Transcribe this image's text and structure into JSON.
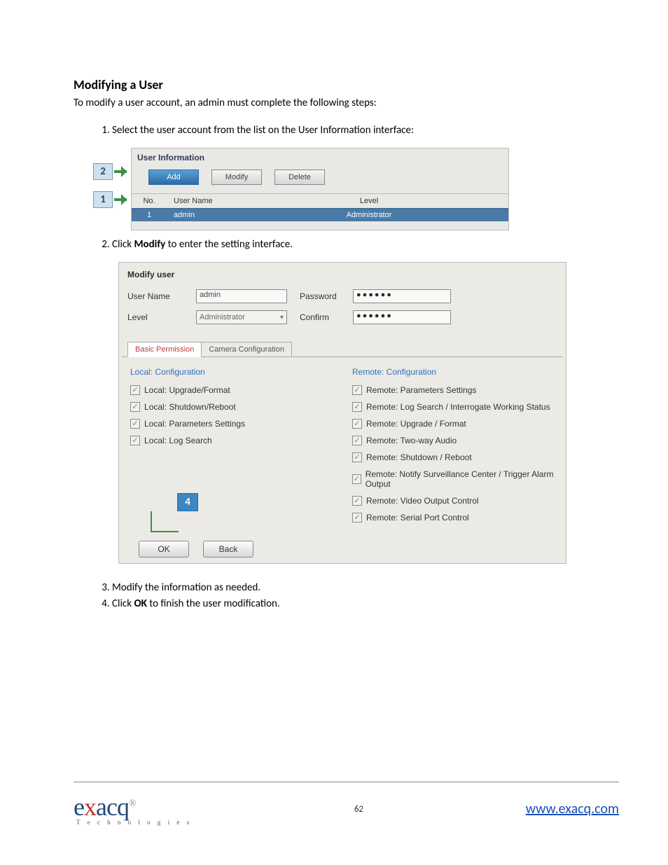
{
  "heading": "Modifying a User",
  "intro": "To modify a user account, an admin must complete the following steps:",
  "step1": "Select the user account from the list on the User Information interface:",
  "step2_pre": "Click ",
  "step2_bold": "Modify",
  "step2_post": " to enter the setting interface.",
  "step3": "Modify the information as needed.",
  "step4_pre": "Click ",
  "step4_bold": "OK",
  "step4_post": " to finish the user modification.",
  "callouts": {
    "c1": "1",
    "c2": "2",
    "c4": "4"
  },
  "panel1": {
    "title": "User Information",
    "buttons": {
      "add": "Add",
      "modify": "Modify",
      "delete": "Delete"
    },
    "headers": {
      "no": "No.",
      "username": "User Name",
      "level": "Level"
    },
    "row": {
      "no": "1",
      "username": "admin",
      "level": "Administrator"
    }
  },
  "panel2": {
    "title": "Modify user",
    "labels": {
      "username": "User Name",
      "password": "Password",
      "level": "Level",
      "confirm": "Confirm"
    },
    "values": {
      "username": "admin",
      "level": "Administrator",
      "password": "●●●●●●",
      "confirm": "●●●●●●"
    },
    "tabs": {
      "basic": "Basic Permission",
      "camera": "Camera Configuration"
    },
    "local_head": "Local: Configuration",
    "remote_head": "Remote: Configuration",
    "local": [
      "Local: Upgrade/Format",
      "Local: Shutdown/Reboot",
      "Local: Parameters Settings",
      "Local: Log Search"
    ],
    "remote": [
      "Remote: Parameters Settings",
      "Remote: Log Search / Interrogate Working Status",
      "Remote: Upgrade / Format",
      "Remote: Two-way Audio",
      "Remote: Shutdown / Reboot",
      "Remote: Notify Surveillance Center / Trigger Alarm Output",
      "Remote: Video Output Control",
      "Remote: Serial Port Control"
    ],
    "actions": {
      "ok": "OK",
      "back": "Back"
    }
  },
  "footer": {
    "page": "62",
    "link": "www.exacq.com",
    "logo_sub": "T e c h n o l o g i e s"
  }
}
